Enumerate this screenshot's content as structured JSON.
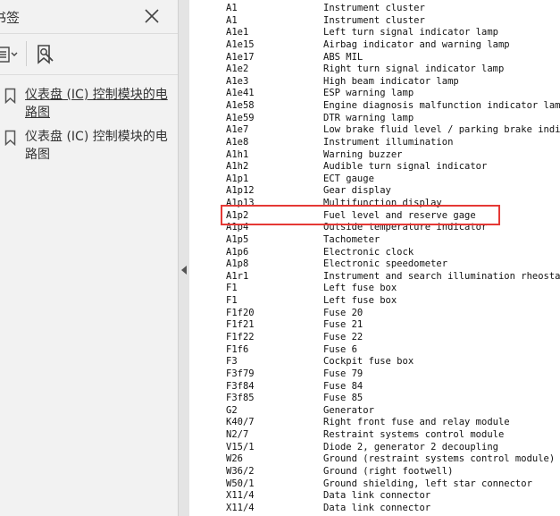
{
  "panel": {
    "title": "书签",
    "bookmarks": [
      {
        "label": "仪表盘 (IC) 控制模块的电路图"
      },
      {
        "label": "仪表盘 (IC) 控制模块的电路图"
      }
    ]
  },
  "doc": {
    "rows": [
      {
        "code": "A1",
        "desc": "Instrument cluster"
      },
      {
        "code": "A1",
        "desc": "Instrument cluster"
      },
      {
        "code": "A1e1",
        "desc": "Left turn signal indicator lamp"
      },
      {
        "code": "A1e15",
        "desc": "Airbag indicator and warning lamp"
      },
      {
        "code": "A1e17",
        "desc": "ABS MIL"
      },
      {
        "code": "A1e2",
        "desc": "Right turn signal indicator lamp"
      },
      {
        "code": "A1e3",
        "desc": "High beam indicator lamp"
      },
      {
        "code": "A1e41",
        "desc": "ESP warning lamp"
      },
      {
        "code": "A1e58",
        "desc": "Engine diagnosis malfunction indicator lamp"
      },
      {
        "code": "A1e59",
        "desc": "DTR warning lamp"
      },
      {
        "code": "A1e7",
        "desc": "Low brake fluid level / parking brake indicator l"
      },
      {
        "code": "A1e8",
        "desc": "Instrument illumination"
      },
      {
        "code": "A1h1",
        "desc": "Warning buzzer"
      },
      {
        "code": "A1h2",
        "desc": "Audible turn signal indicator"
      },
      {
        "code": "A1p1",
        "desc": "ECT gauge"
      },
      {
        "code": "A1p12",
        "desc": "Gear display"
      },
      {
        "code": "A1p13",
        "desc": "Multifunction display"
      },
      {
        "code": "A1p2",
        "desc": "Fuel level and reserve gage"
      },
      {
        "code": "A1p4",
        "desc": "Outside temperature indicator"
      },
      {
        "code": "A1p5",
        "desc": "Tachometer"
      },
      {
        "code": "A1p6",
        "desc": "Electronic clock"
      },
      {
        "code": "A1p8",
        "desc": "Electronic speedometer"
      },
      {
        "code": "A1r1",
        "desc": "Instrument and search illumination rheostat"
      },
      {
        "code": "F1",
        "desc": "Left fuse box"
      },
      {
        "code": "F1",
        "desc": "Left fuse box"
      },
      {
        "code": "F1f20",
        "desc": "Fuse 20"
      },
      {
        "code": "F1f21",
        "desc": "Fuse 21"
      },
      {
        "code": "F1f22",
        "desc": "Fuse 22"
      },
      {
        "code": "F1f6",
        "desc": "Fuse 6"
      },
      {
        "code": "F3",
        "desc": "Cockpit fuse box"
      },
      {
        "code": "F3f79",
        "desc": "Fuse 79"
      },
      {
        "code": "F3f84",
        "desc": "Fuse 84"
      },
      {
        "code": "F3f85",
        "desc": "Fuse 85"
      },
      {
        "code": "G2",
        "desc": "Generator"
      },
      {
        "code": "K40/7",
        "desc": "Right front fuse and relay module"
      },
      {
        "code": "N2/7",
        "desc": "Restraint systems control module"
      },
      {
        "code": "V15/1",
        "desc": "Diode 2, generator 2 decoupling"
      },
      {
        "code": "W26",
        "desc": "Ground (restraint systems control module)"
      },
      {
        "code": "W36/2",
        "desc": "Ground (right footwell)"
      },
      {
        "code": "W50/1",
        "desc": "Ground shielding, left star connector"
      },
      {
        "code": "X11/4",
        "desc": "Data link connector"
      },
      {
        "code": "X11/4",
        "desc": "Data link connector"
      }
    ]
  },
  "colors": {
    "highlight": "#e53935",
    "panel_bg": "#f2f2f2"
  },
  "icons": [
    "close-icon",
    "options-menu-icon",
    "find-bookmark-icon",
    "bookmark-icon",
    "collapse-arrow-icon"
  ]
}
